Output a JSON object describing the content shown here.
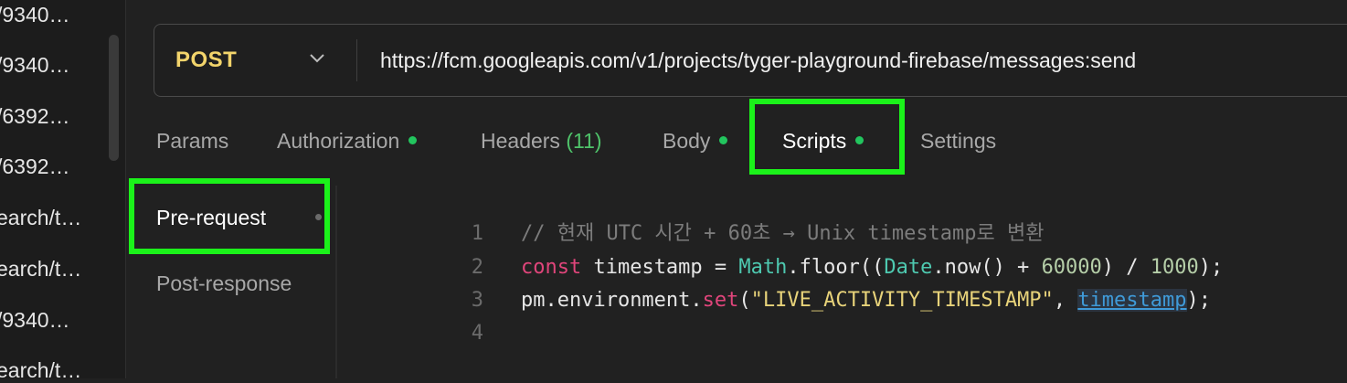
{
  "sidebar": {
    "items": [
      "/9340…",
      "/9340…",
      "/6392…",
      "/6392…",
      "earch/t…",
      "earch/t…",
      "/9340…",
      "earch/t…"
    ]
  },
  "request": {
    "method": "POST",
    "url": "https://fcm.googleapis.com/v1/projects/tyger-playground-firebase/messages:send"
  },
  "tabs": {
    "params": "Params",
    "authorization": "Authorization",
    "headers": "Headers",
    "headers_count": "(11)",
    "body": "Body",
    "scripts": "Scripts",
    "settings": "Settings"
  },
  "script_tabs": {
    "pre_request": "Pre-request",
    "post_response": "Post-response"
  },
  "editor": {
    "line_numbers": [
      "1",
      "2",
      "3",
      "4"
    ],
    "line1": {
      "comment": "// 현재 UTC 시간 + 60초 → Unix timestamp로 변환"
    },
    "line2": {
      "kw": "const",
      "a": " timestamp = ",
      "cls": "Math",
      "b": ".floor((",
      "cls2": "Date",
      "c": ".now() + ",
      "num1": "60000",
      "d": ") / ",
      "num2": "1000",
      "e": ");"
    },
    "line3": {
      "a": "pm.environment.",
      "fn": "set",
      "b": "(",
      "str": "\"LIVE_ACTIVITY_TIMESTAMP\"",
      "c": ", ",
      "link": "timestamp",
      "d": ");"
    }
  },
  "colors": {
    "highlight": "#1bf21a",
    "status_dot": "#22c55e",
    "method": "#f2d46b",
    "keyword": "#e0457b",
    "string": "#e8d37a"
  }
}
